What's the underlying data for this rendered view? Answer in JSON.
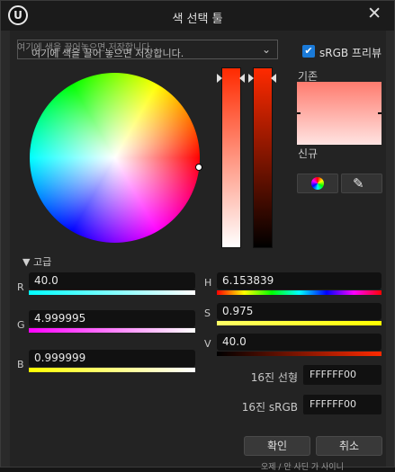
{
  "window": {
    "title": "색 선택 툴",
    "close_icon": "close-icon",
    "logo_icon": "unreal-logo",
    "logo_glyph": "U"
  },
  "presets": {
    "hint": "여기에 색을 끌어놓으면 저장합니다",
    "text": "여기에 색을 끌어 놓으면 저장합니다.",
    "dropdown_icon": "chevron-down-icon"
  },
  "srgb": {
    "label": "sRGB 프리뷰",
    "checked": true
  },
  "color_wheel": {
    "hue_deg": 5,
    "saturation": 0.975,
    "value": 40.0
  },
  "preview": {
    "old_label": "기존",
    "new_label": "신규",
    "old_color": "#ff7b6e",
    "new_color": "#ffe4e2"
  },
  "tools": {
    "wheel_button_icon": "color-wheel-icon",
    "eyedropper_button_icon": "eyedropper-icon"
  },
  "advanced": {
    "label": "고급",
    "expand_icon": "triangle-down-icon"
  },
  "rgb": [
    {
      "label": "R",
      "value": "40.0"
    },
    {
      "label": "G",
      "value": "4.999995"
    },
    {
      "label": "B",
      "value": "0.999999"
    }
  ],
  "hsv": [
    {
      "label": "H",
      "value": "6.153839"
    },
    {
      "label": "S",
      "value": "0.975"
    },
    {
      "label": "V",
      "value": "40.0"
    }
  ],
  "hex": {
    "linear_label": "16진 선형",
    "linear_value": "FFFFFF00",
    "srgb_label": "16진 sRGB",
    "srgb_value": "FFFFFF00"
  },
  "buttons": {
    "ok": "확인",
    "cancel": "취소"
  },
  "background_text": "오제 / 안 사딘 가 사이니"
}
